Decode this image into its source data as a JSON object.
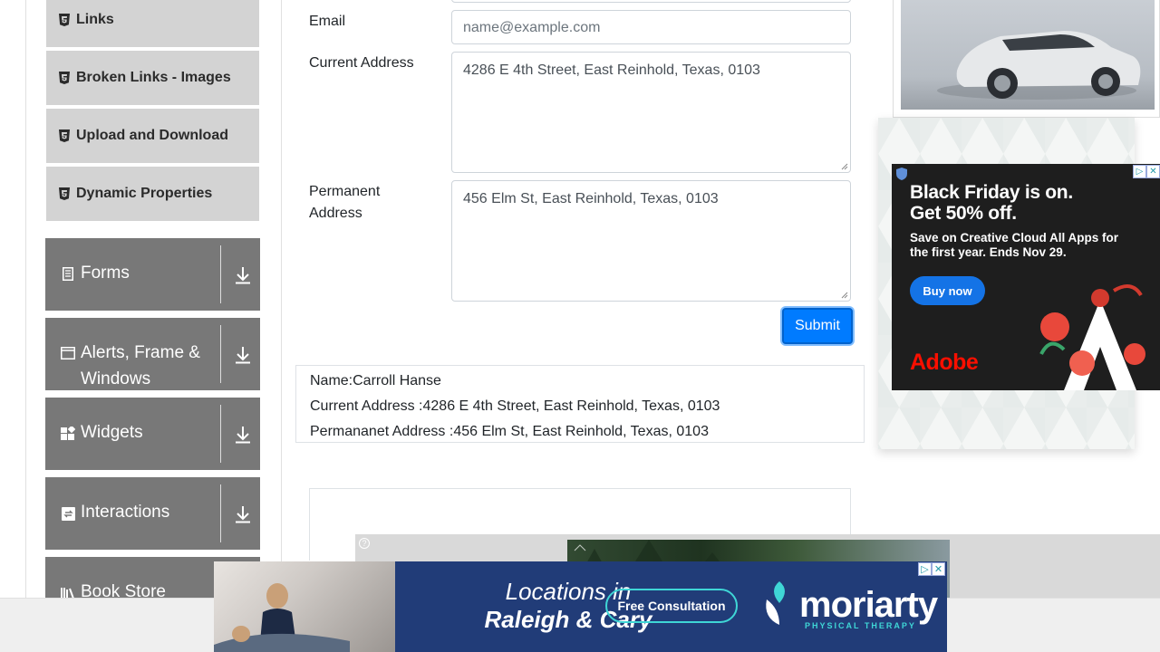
{
  "sidebar": {
    "elements_items": [
      {
        "label": "Links",
        "icon": "html5-icon"
      },
      {
        "label": "Broken Links - Images",
        "icon": "html5-icon"
      },
      {
        "label": "Upload and Download",
        "icon": "html5-icon"
      },
      {
        "label": "Dynamic Properties",
        "icon": "html5-icon"
      }
    ],
    "groups": [
      {
        "label": "Forms",
        "icon": "document-icon"
      },
      {
        "label": "Alerts, Frame & Windows",
        "icon": "window-icon"
      },
      {
        "label": "Widgets",
        "icon": "widgets-icon"
      },
      {
        "label": "Interactions",
        "icon": "interactions-icon"
      },
      {
        "label": "Book Store",
        "icon": "books-icon"
      }
    ]
  },
  "form": {
    "email_label": "Email",
    "email_placeholder": "name@example.com",
    "email_value": "",
    "current_address_label": "Current Address",
    "current_address_value": "4286 E 4th Street, East Reinhold, Texas, 0103",
    "permanent_address_label_line1": "Permanent",
    "permanent_address_label_line2": "Address",
    "permanent_address_value": "456 Elm St, East Reinhold, Texas, 0103",
    "submit_label": "Submit"
  },
  "output": {
    "name_line": "Name:Carroll Hanse",
    "current_address_line": "Current Address :4286 E 4th Street, East Reinhold, Texas, 0103",
    "permanent_address_line": "Permananet Address :456 Elm St, East Reinhold, Texas, 0103"
  },
  "ads": {
    "adobe": {
      "headline_line1": "Black Friday is on.",
      "headline_line2": "Get 50% off.",
      "subtext": "Save on Creative Cloud All Apps for the first year. Ends Nov 29.",
      "button": "Buy now",
      "brand": "Adobe",
      "brand_color": "#fa0f00"
    },
    "moriarty": {
      "line1": "Locations in",
      "line2": "Raleigh & Cary",
      "cta": "Free Consultation",
      "logo": "moriarty",
      "logo_sub": "PHYSICAL THERAPY"
    },
    "choices_icon": "adchoices-icon",
    "close_icon": "close-icon",
    "help_icon": "?"
  },
  "colors": {
    "sidebar_group_bg": "#787878",
    "sidebar_item_bg": "#d3d3d3",
    "primary": "#007bff"
  }
}
